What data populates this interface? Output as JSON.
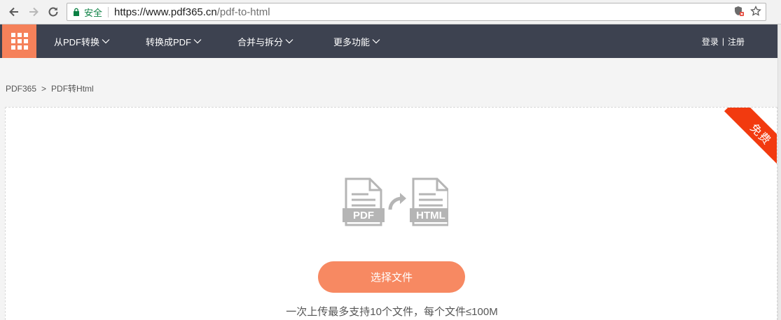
{
  "browser": {
    "secure_label": "安全",
    "url_host": "https://www.pdf365.cn",
    "url_path": "/pdf-to-html",
    "icons": [
      "back-arrow-icon",
      "forward-arrow-icon",
      "reload-icon",
      "lock-icon",
      "shield-blocked-icon",
      "star-icon"
    ]
  },
  "header": {
    "menu": [
      {
        "label": "从PDF转换"
      },
      {
        "label": "转换成PDF"
      },
      {
        "label": "合并与拆分"
      },
      {
        "label": "更多功能"
      }
    ],
    "login_label": "登录",
    "separator": "|",
    "register_label": "注册",
    "bg_color": "#3d4250",
    "logo_color": "#f5815a"
  },
  "breadcrumb": {
    "home": "PDF365",
    "separator": ">",
    "current": "PDF转Html"
  },
  "upload": {
    "ribbon_label": "免费",
    "ribbon_color": "#f23a0f",
    "source_format": "PDF",
    "target_format": "HTML",
    "choose_button_label": "选择文件",
    "button_color": "#f78962",
    "hint": "一次上传最多支持10个文件，每个文件≤100M"
  }
}
